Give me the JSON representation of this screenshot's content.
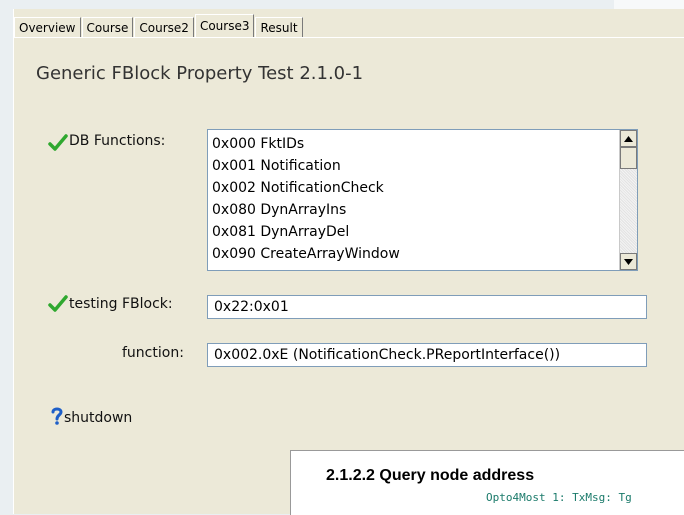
{
  "tabs": [
    {
      "label": "Overview"
    },
    {
      "label": "Course"
    },
    {
      "label": "Course2"
    },
    {
      "label": "Course3",
      "active": true
    },
    {
      "label": "Result"
    }
  ],
  "page": {
    "title": "Generic FBlock Property Test 2.1.0-1"
  },
  "db_functions": {
    "label": "DB Functions:",
    "items": [
      "0x000 FktIDs",
      "0x001 Notification",
      "0x002 NotificationCheck",
      "0x080 DynArrayIns",
      "0x081 DynArrayDel",
      "0x090 CreateArrayWindow"
    ]
  },
  "testing_fblock": {
    "label": "testing FBlock:",
    "value": "0x22:0x01"
  },
  "function": {
    "label": "function:",
    "value": "0x002.0xE (NotificationCheck.PReportInterface())"
  },
  "shutdown": {
    "label": "shutdown"
  },
  "document": {
    "heading": "2.1.2.2 Query node address",
    "code": "Opto4Most 1: TxMsg: Tg"
  },
  "colors": {
    "check": "#2fa82f",
    "question": "#1e5fc8",
    "code": "#1a7a6a"
  }
}
